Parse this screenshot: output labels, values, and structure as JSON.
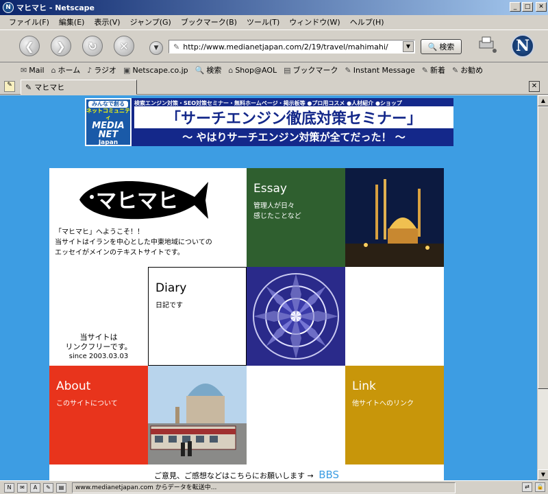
{
  "window": {
    "title": "マヒマヒ - Netscape",
    "app_icon": "netscape-n-icon",
    "minimize": "_",
    "maximize": "□",
    "close": "✕"
  },
  "menu": [
    "ファイル(F)",
    "編集(E)",
    "表示(V)",
    "ジャンプ(G)",
    "ブックマーク(B)",
    "ツール(T)",
    "ウィンドウ(W)",
    "ヘルプ(H)"
  ],
  "toolbar": {
    "url": "http://www.medianetjapan.com/2/19/travel/mahimahi/",
    "search_label": "検索",
    "logo_letter": "N"
  },
  "personal_toolbar": [
    {
      "icon": "mail-icon",
      "label": "Mail"
    },
    {
      "icon": "home-icon",
      "label": "ホーム"
    },
    {
      "icon": "radio-icon",
      "label": "ラジオ"
    },
    {
      "icon": "netscape-icon",
      "label": "Netscape.co.jp"
    },
    {
      "icon": "search-icon",
      "label": "検索"
    },
    {
      "icon": "shop-icon",
      "label": "Shop@AOL"
    },
    {
      "icon": "bookmark-icon",
      "label": "ブックマーク"
    },
    {
      "icon": "im-icon",
      "label": "Instant Message"
    },
    {
      "icon": "link-icon",
      "label": "新着"
    },
    {
      "icon": "link-icon",
      "label": "お勧め"
    }
  ],
  "tab": {
    "label": "マヒマヒ"
  },
  "banner": {
    "logo_top": "みんなで創る",
    "logo_mid": "ネットコミュニティ",
    "logo_brand1": "MEDIA",
    "logo_brand2": "NET",
    "logo_brand3": "Japan",
    "top_line": "検索エンジン対策・SEO対策セミナー・無料ホームページ・掲示板等 ●プロ用コスメ ●人材紹介 ●ショップ",
    "headline": "「サーチエンジン徹底対策セミナー」",
    "subline": "〜 やはりサーチエンジン対策が全てだった！ 〜"
  },
  "site": {
    "logo_text": "マヒマヒ",
    "welcome_line1": "「マヒマヒ」へようこそ！！",
    "welcome_line2": "当サイトはイランを中心とした中東地域についての",
    "welcome_line3": "エッセイがメインのテキストサイトです。",
    "essay_title": "Essay",
    "essay_desc1": "管理人が日々",
    "essay_desc2": "感じたことなど",
    "diary_title": "Diary",
    "diary_desc": "日記です",
    "linkfree_line1": "当サイトは",
    "linkfree_line2": "リンクフリーです。",
    "linkfree_since": "since 2003.03.03",
    "about_title": "About",
    "about_desc": "このサイトについて",
    "link_title": "Link",
    "link_desc": "他サイトへのリンク",
    "footer_text": "ご意見、ご感想などはこちらにお願いします →",
    "bbs_label": "BBS",
    "colors": {
      "background": "#3d9de3",
      "essay": "#2f5f2f",
      "about": "#e8341c",
      "link": "#c8960a"
    }
  },
  "status": {
    "text": "www.medianetjapan.com からデータを転送中..."
  }
}
